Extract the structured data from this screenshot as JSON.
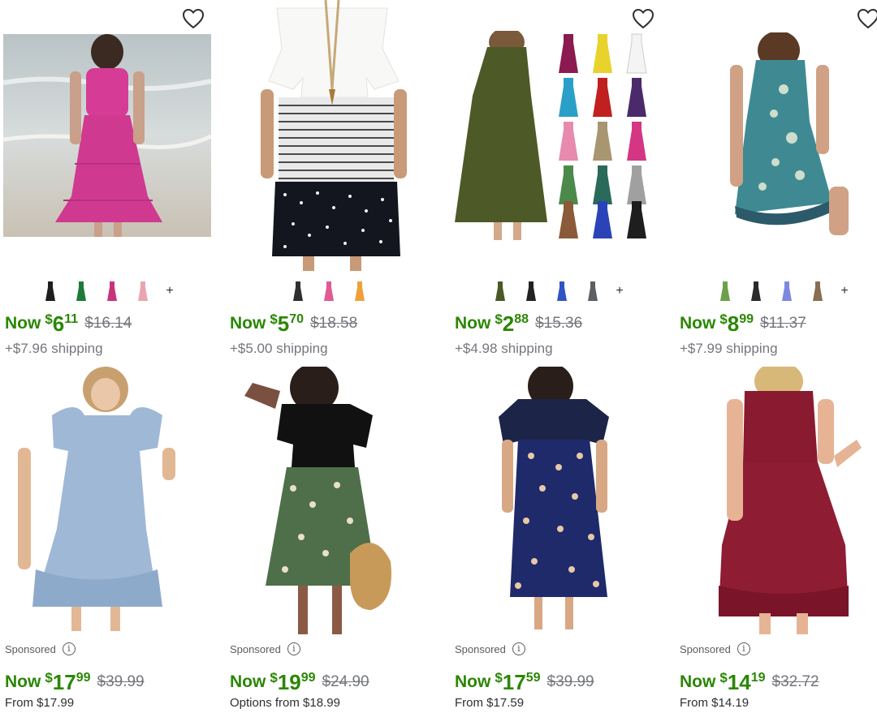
{
  "products": [
    {
      "now_label": "Now",
      "currency": "$",
      "dollars": "6",
      "cents": "11",
      "was": "$16.14",
      "subtext": "+$7.96 shipping",
      "image": "pink-sleeveless-tiered-dress-beach",
      "swatches": [
        "#1e1e1e",
        "#1f7a3a",
        "#c8347c",
        "#e8a5ad"
      ],
      "more": "+"
    },
    {
      "now_label": "Now",
      "currency": "$",
      "dollars": "5",
      "cents": "70",
      "was": "$18.58",
      "subtext": "+$5.00 shipping",
      "image": "white-striped-polka-dot-dress",
      "swatches": [
        "#303030",
        "#e05a93",
        "#f0a03a"
      ],
      "more": ""
    },
    {
      "now_label": "Now",
      "currency": "$",
      "dollars": "2",
      "cents": "88",
      "was": "$15.36",
      "subtext": "+$4.98 shipping",
      "image": "olive-sleeveless-dress-color-grid",
      "swatches": [
        "#4a5a26",
        "#222222",
        "#2f54c6",
        "#5c5f63"
      ],
      "more": "+"
    },
    {
      "now_label": "Now",
      "currency": "$",
      "dollars": "8",
      "cents": "99",
      "was": "$11.37",
      "subtext": "+$7.99 shipping",
      "image": "teal-floral-tank-dress",
      "swatches": [
        "#6ea04a",
        "#2a2a2a",
        "#7f88e0",
        "#8a6d52"
      ],
      "more": "+"
    },
    {
      "now_label": "Now",
      "currency": "$",
      "dollars": "17",
      "cents": "99",
      "was": "$39.99",
      "subtext": "From $17.99",
      "sponsored": "Sponsored",
      "image": "light-blue-ruffle-sleeve-dress"
    },
    {
      "now_label": "Now",
      "currency": "$",
      "dollars": "19",
      "cents": "99",
      "was": "$24.90",
      "subtext": "Options from $18.99",
      "sponsored": "Sponsored",
      "image": "black-top-floral-skirt-dress"
    },
    {
      "now_label": "Now",
      "currency": "$",
      "dollars": "17",
      "cents": "59",
      "was": "$39.99",
      "subtext": "From $17.59",
      "sponsored": "Sponsored",
      "image": "navy-floral-maxi-dress"
    },
    {
      "now_label": "Now",
      "currency": "$",
      "dollars": "14",
      "cents": "19",
      "was": "$32.72",
      "subtext": "From $14.19",
      "sponsored": "Sponsored",
      "image": "burgundy-sleeveless-ruffle-dress"
    }
  ],
  "icons": {
    "favorite": "heart-outline-icon",
    "info": "info-circle-icon"
  },
  "colors": {
    "price_green": "#2a8703",
    "strike_gray": "#74767c"
  }
}
